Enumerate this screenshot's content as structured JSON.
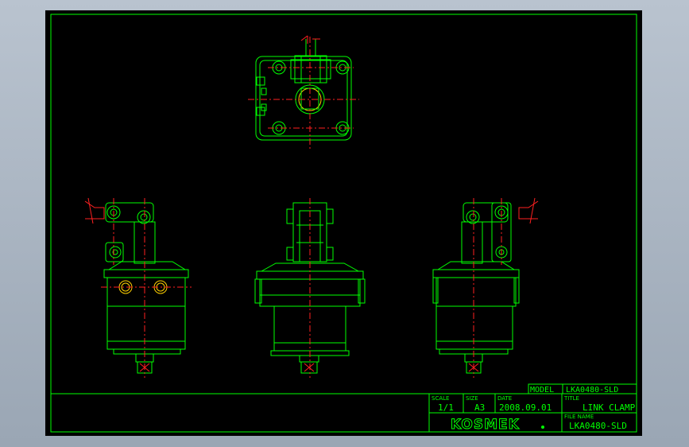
{
  "title_block": {
    "model_label": "MODEL",
    "model_value": "LKA0480-SLD",
    "scale_label": "SCALE",
    "scale_value": "1/1",
    "size_label": "SIZE",
    "size_value": "A3",
    "date_label": "DATE",
    "date_value": "2008.09.01",
    "title_label": "TITLE",
    "title_value": "LINK CLAMP",
    "file_label": "FILE NAME",
    "file_value": "LKA0480-SLD",
    "company_logo": "KOSMEK"
  },
  "colors": {
    "background": "#000000",
    "outline": "#00ff00",
    "center_line": "#ff2020",
    "hidden": "#ffd000"
  }
}
